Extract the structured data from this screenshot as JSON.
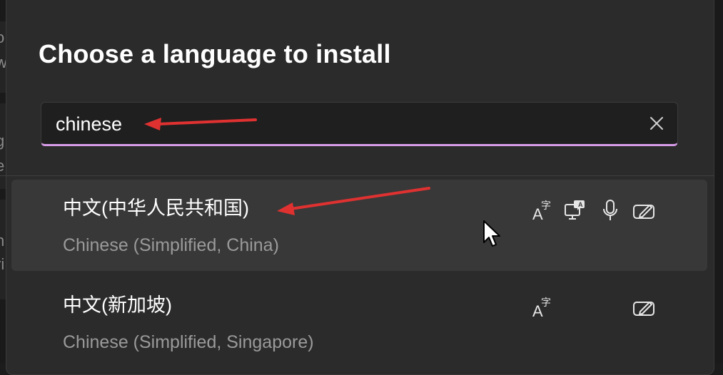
{
  "dialog": {
    "title": "Choose a language to install"
  },
  "search": {
    "value": "chinese",
    "clear_icon": "close-icon",
    "focus_color": "#d69be6"
  },
  "results": [
    {
      "native_name": "中文(中华人民共和国)",
      "english_name": "Chinese (Simplified, China)",
      "selected": true,
      "features": [
        "language-pack-icon",
        "display-language-icon",
        "speech-icon",
        "handwriting-icon"
      ]
    },
    {
      "native_name": "中文(新加坡)",
      "english_name": "Chinese (Simplified, Singapore)",
      "selected": false,
      "features": [
        "language-pack-icon",
        "handwriting-icon"
      ]
    }
  ],
  "annotation_color": "#e03131",
  "background_fragments": [
    "o",
    "w",
    "g",
    "e",
    "h",
    "ri"
  ]
}
